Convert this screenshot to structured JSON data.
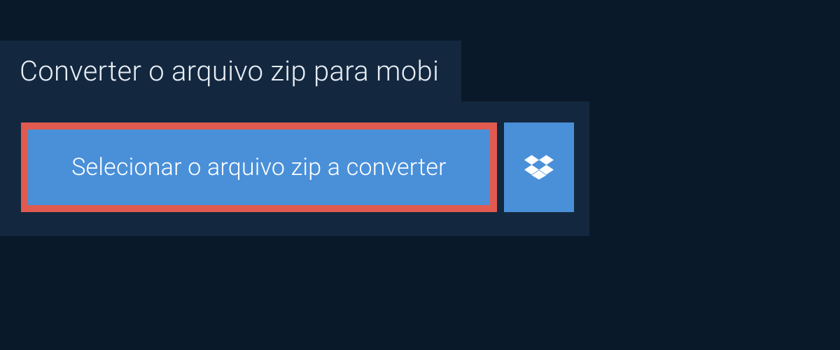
{
  "header": {
    "title": "Converter o arquivo zip para mobi"
  },
  "actions": {
    "select_file_label": "Selecionar o arquivo zip a converter"
  },
  "colors": {
    "background": "#0a1929",
    "panel": "#13283f",
    "button": "#4a90d9",
    "highlight_border": "#e05a4f",
    "text": "#e8eef5"
  }
}
